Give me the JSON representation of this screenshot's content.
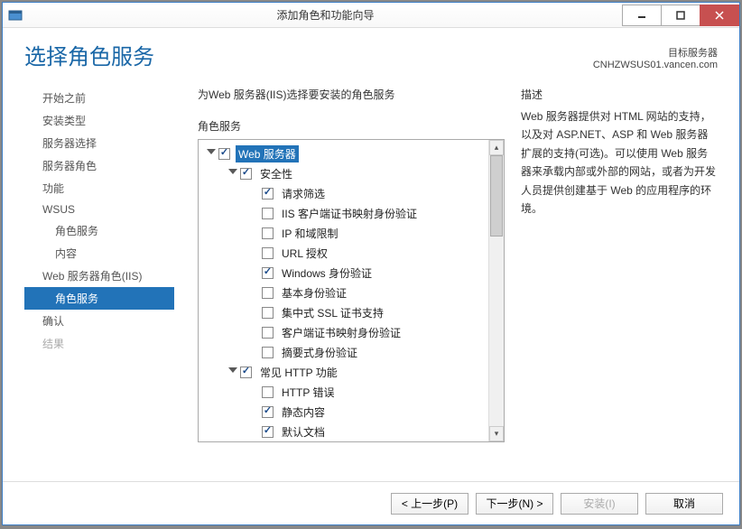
{
  "window": {
    "title": "添加角色和功能向导"
  },
  "header": {
    "page_title": "选择角色服务",
    "dest_label": "目标服务器",
    "dest_server": "CNHZWSUS01.vancen.com"
  },
  "nav": [
    {
      "label": "开始之前",
      "indent": 0
    },
    {
      "label": "安装类型",
      "indent": 0
    },
    {
      "label": "服务器选择",
      "indent": 0
    },
    {
      "label": "服务器角色",
      "indent": 0
    },
    {
      "label": "功能",
      "indent": 0
    },
    {
      "label": "WSUS",
      "indent": 0
    },
    {
      "label": "角色服务",
      "indent": 1
    },
    {
      "label": "内容",
      "indent": 1
    },
    {
      "label": "Web 服务器角色(IIS)",
      "indent": 0
    },
    {
      "label": "角色服务",
      "indent": 1,
      "selected": true
    },
    {
      "label": "确认",
      "indent": 0
    },
    {
      "label": "结果",
      "indent": 0,
      "disabled": true
    }
  ],
  "center": {
    "instruction": "为Web 服务器(IIS)选择要安装的角色服务",
    "tree_label": "角色服务",
    "desc_label": "描述",
    "description": "Web 服务器提供对 HTML 网站的支持，以及对 ASP.NET、ASP 和 Web 服务器扩展的支持(可选)。可以使用 Web 服务器来承载内部或外部的网站，或者为开发人员提供创建基于 Web 的应用程序的环境。"
  },
  "tree": [
    {
      "label": "Web 服务器",
      "depth": 0,
      "expander": true,
      "checked": true,
      "highlight": true
    },
    {
      "label": "安全性",
      "depth": 1,
      "expander": true,
      "checked": true
    },
    {
      "label": "请求筛选",
      "depth": 2,
      "checked": true
    },
    {
      "label": "IIS 客户端证书映射身份验证",
      "depth": 2,
      "checked": false
    },
    {
      "label": "IP 和域限制",
      "depth": 2,
      "checked": false
    },
    {
      "label": "URL 授权",
      "depth": 2,
      "checked": false
    },
    {
      "label": "Windows 身份验证",
      "depth": 2,
      "checked": true
    },
    {
      "label": "基本身份验证",
      "depth": 2,
      "checked": false
    },
    {
      "label": "集中式 SSL 证书支持",
      "depth": 2,
      "checked": false
    },
    {
      "label": "客户端证书映射身份验证",
      "depth": 2,
      "checked": false
    },
    {
      "label": "摘要式身份验证",
      "depth": 2,
      "checked": false
    },
    {
      "label": "常见 HTTP 功能",
      "depth": 1,
      "expander": true,
      "checked": true
    },
    {
      "label": "HTTP 错误",
      "depth": 2,
      "checked": false
    },
    {
      "label": "静态内容",
      "depth": 2,
      "checked": true
    },
    {
      "label": "默认文档",
      "depth": 2,
      "checked": true
    }
  ],
  "footer": {
    "prev": "< 上一步(P)",
    "next": "下一步(N) >",
    "install": "安装(I)",
    "cancel": "取消"
  }
}
